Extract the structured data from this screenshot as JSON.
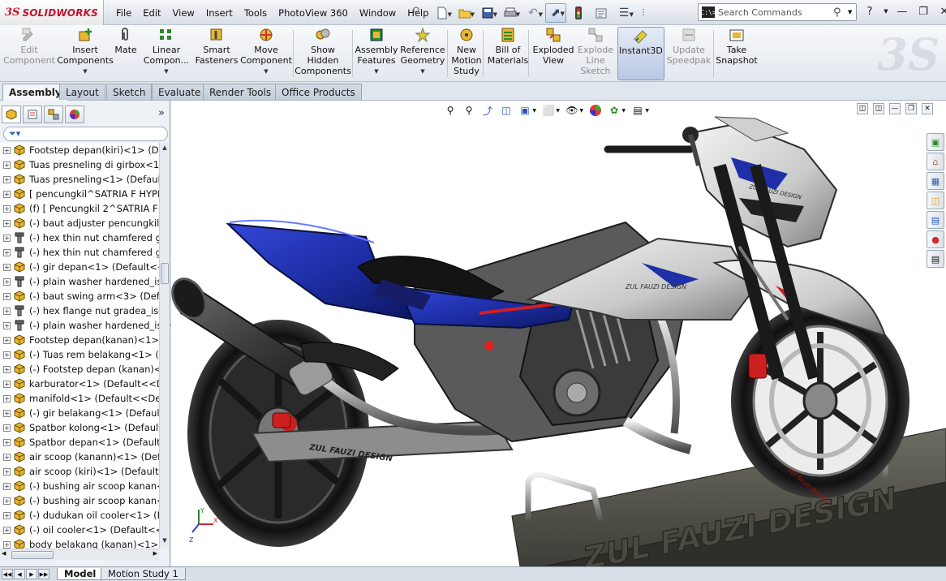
{
  "app": {
    "brand": "SOLIDWORKS",
    "brand_prefix": "3S"
  },
  "menu": [
    "File",
    "Edit",
    "View",
    "Insert",
    "Tools",
    "PhotoView 360",
    "Window",
    "Help"
  ],
  "search": {
    "placeholder": "Search Commands",
    "prompt_icon": "C:\\>"
  },
  "command_manager": [
    {
      "id": "edit-component",
      "label": "Edit Component",
      "lines": [
        "Edit",
        "Component"
      ],
      "disabled": true,
      "icon": "edit-component-icon"
    },
    {
      "id": "insert-components",
      "label": "Insert Components",
      "lines": [
        "Insert",
        "Components"
      ],
      "icon": "insert-components-icon",
      "dropdown": true
    },
    {
      "id": "mate",
      "label": "Mate",
      "lines": [
        "Mate"
      ],
      "icon": "paperclip-icon"
    },
    {
      "id": "linear-component",
      "label": "Linear Compon...",
      "lines": [
        "Linear",
        "Compon..."
      ],
      "icon": "linear-pattern-icon",
      "dropdown": true
    },
    {
      "id": "smart-fasteners",
      "label": "Smart Fasteners",
      "lines": [
        "Smart",
        "Fasteners"
      ],
      "icon": "smart-fasteners-icon"
    },
    {
      "id": "move-component",
      "label": "Move Component",
      "lines": [
        "Move",
        "Component"
      ],
      "icon": "move-component-icon",
      "dropdown": true
    },
    {
      "id": "show-hidden",
      "label": "Show Hidden Components",
      "lines": [
        "Show",
        "Hidden",
        "Components"
      ],
      "icon": "show-hidden-icon"
    },
    {
      "id": "assembly-features",
      "label": "Assembly Features",
      "lines": [
        "Assembly",
        "Features"
      ],
      "icon": "assembly-features-icon",
      "dropdown": true
    },
    {
      "id": "reference-geometry",
      "label": "Reference Geometry",
      "lines": [
        "Reference",
        "Geometry"
      ],
      "icon": "reference-geometry-icon",
      "dropdown": true
    },
    {
      "id": "new-motion-study",
      "label": "New Motion Study",
      "lines": [
        "New",
        "Motion",
        "Study"
      ],
      "icon": "motion-study-icon"
    },
    {
      "id": "bill-of-materials",
      "label": "Bill of Materials",
      "lines": [
        "Bill of",
        "Materials"
      ],
      "icon": "bom-icon"
    },
    {
      "id": "exploded-view",
      "label": "Exploded View",
      "lines": [
        "Exploded",
        "View"
      ],
      "icon": "exploded-view-icon"
    },
    {
      "id": "explode-line-sketch",
      "label": "Explode Line Sketch",
      "lines": [
        "Explode",
        "Line",
        "Sketch"
      ],
      "disabled": true,
      "icon": "explode-line-icon"
    },
    {
      "id": "instant3d",
      "label": "Instant3D",
      "lines": [
        "Instant3D"
      ],
      "active": true,
      "icon": "instant3d-icon"
    },
    {
      "id": "update-speedpak",
      "label": "Update Speedpak",
      "lines": [
        "Update",
        "Speedpak"
      ],
      "disabled": true,
      "icon": "speedpak-icon"
    },
    {
      "id": "take-snapshot",
      "label": "Take Snapshot",
      "lines": [
        "Take",
        "Snapshot"
      ],
      "icon": "snapshot-icon"
    }
  ],
  "tabs": [
    "Assembly",
    "Layout",
    "Sketch",
    "Evaluate",
    "Render Tools",
    "Office Products"
  ],
  "active_tab": "Assembly",
  "feature_tree": [
    {
      "label": "Footstep depan(kiri)<1> (De",
      "icon": "part"
    },
    {
      "label": "Tuas presneling di girbox<1>",
      "icon": "part"
    },
    {
      "label": "Tuas presneling<1> (Default",
      "icon": "part"
    },
    {
      "label": "[ pencungkil^SATRIA F HYPI",
      "icon": "part"
    },
    {
      "label": "(f) [ Pencungkil 2^SATRIA F",
      "icon": "part"
    },
    {
      "label": "(-) baut adjuster pencungkil",
      "icon": "part"
    },
    {
      "label": "(-) hex thin nut chamfered g",
      "icon": "bolt"
    },
    {
      "label": "(-) hex thin nut chamfered g",
      "icon": "bolt"
    },
    {
      "label": "(-) gir depan<1> (Default<<",
      "icon": "part"
    },
    {
      "label": "(-) plain washer hardened_is",
      "icon": "bolt"
    },
    {
      "label": "(-) baut swing arm<3> (Defa",
      "icon": "part"
    },
    {
      "label": "(-) hex flange nut gradea_iso",
      "icon": "bolt"
    },
    {
      "label": "(-) plain washer hardened_is",
      "icon": "bolt"
    },
    {
      "label": "Footstep depan(kanan)<1> (",
      "icon": "part"
    },
    {
      "label": "(-) Tuas rem belakang<1> (D",
      "icon": "part"
    },
    {
      "label": "(-) Footstep depan (kanan)<",
      "icon": "part"
    },
    {
      "label": "karburator<1> (Default<<De",
      "icon": "part"
    },
    {
      "label": "manifold<1> (Default<<Def",
      "icon": "part"
    },
    {
      "label": "(-) gir belakang<1> (Default",
      "icon": "part"
    },
    {
      "label": "Spatbor kolong<1> (Default",
      "icon": "part"
    },
    {
      "label": "Spatbor depan<1> (Default<",
      "icon": "part"
    },
    {
      "label": "air scoop (kanann)<1> (Defa",
      "icon": "part"
    },
    {
      "label": "air scoop (kiri)<1> (Default<",
      "icon": "part"
    },
    {
      "label": "(-) bushing air scoop kanan<",
      "icon": "part"
    },
    {
      "label": "(-) bushing air scoop kanan<",
      "icon": "part"
    },
    {
      "label": "(-) dudukan oil cooler<1> (D",
      "icon": "part"
    },
    {
      "label": "(-) oil cooler<1> (Default<<I",
      "icon": "part"
    },
    {
      "label": "body belakang (kanan)<1> (",
      "icon": "part"
    }
  ],
  "viewport": {
    "watermark_text": "ZUL FAUZI DESIGN",
    "swingarm_text": "ZUL FAUZI DESIGN",
    "tank_text": "ZUL FAUZI DESIGN",
    "rim_text": "zul fauzi design",
    "axis": {
      "x": "X",
      "y": "Y",
      "z": "Z"
    }
  },
  "bottom_tabs": [
    "Model",
    "Motion Study 1"
  ],
  "active_bottom_tab": "Model",
  "colors": {
    "accent": "#c8102e",
    "body_blue": "#1e2fa8",
    "selection": "#b9c7e4"
  }
}
